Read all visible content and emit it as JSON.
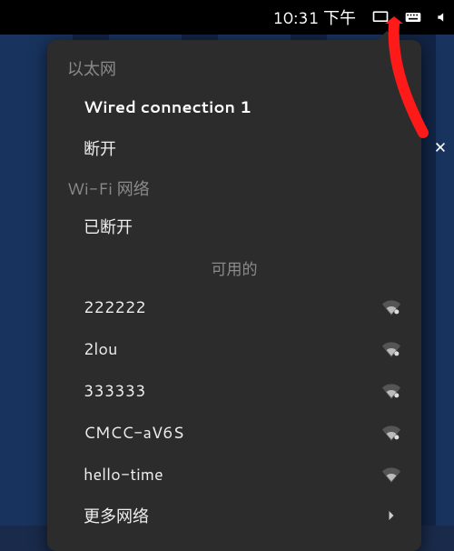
{
  "topbar": {
    "time": "10:31 下午",
    "icons": {
      "network": "network-icon",
      "keyboard": "keyboard-icon",
      "speaker": "speaker-icon"
    }
  },
  "dropdown": {
    "ethernet_header": "以太网",
    "wired_label": "Wired connection 1",
    "disconnect_label": "断开",
    "wifi_header": "Wi-Fi 网络",
    "wifi_disconnected": "已断开",
    "available_header": "可用的",
    "networks": [
      {
        "ssid": "222222",
        "locked": true
      },
      {
        "ssid": "2lou",
        "locked": true
      },
      {
        "ssid": "333333",
        "locked": true
      },
      {
        "ssid": "CMCC-aV6S",
        "locked": true
      },
      {
        "ssid": "hello-time",
        "locked": false
      }
    ],
    "more_label": "更多网络"
  },
  "overlay": {
    "close": "×"
  }
}
